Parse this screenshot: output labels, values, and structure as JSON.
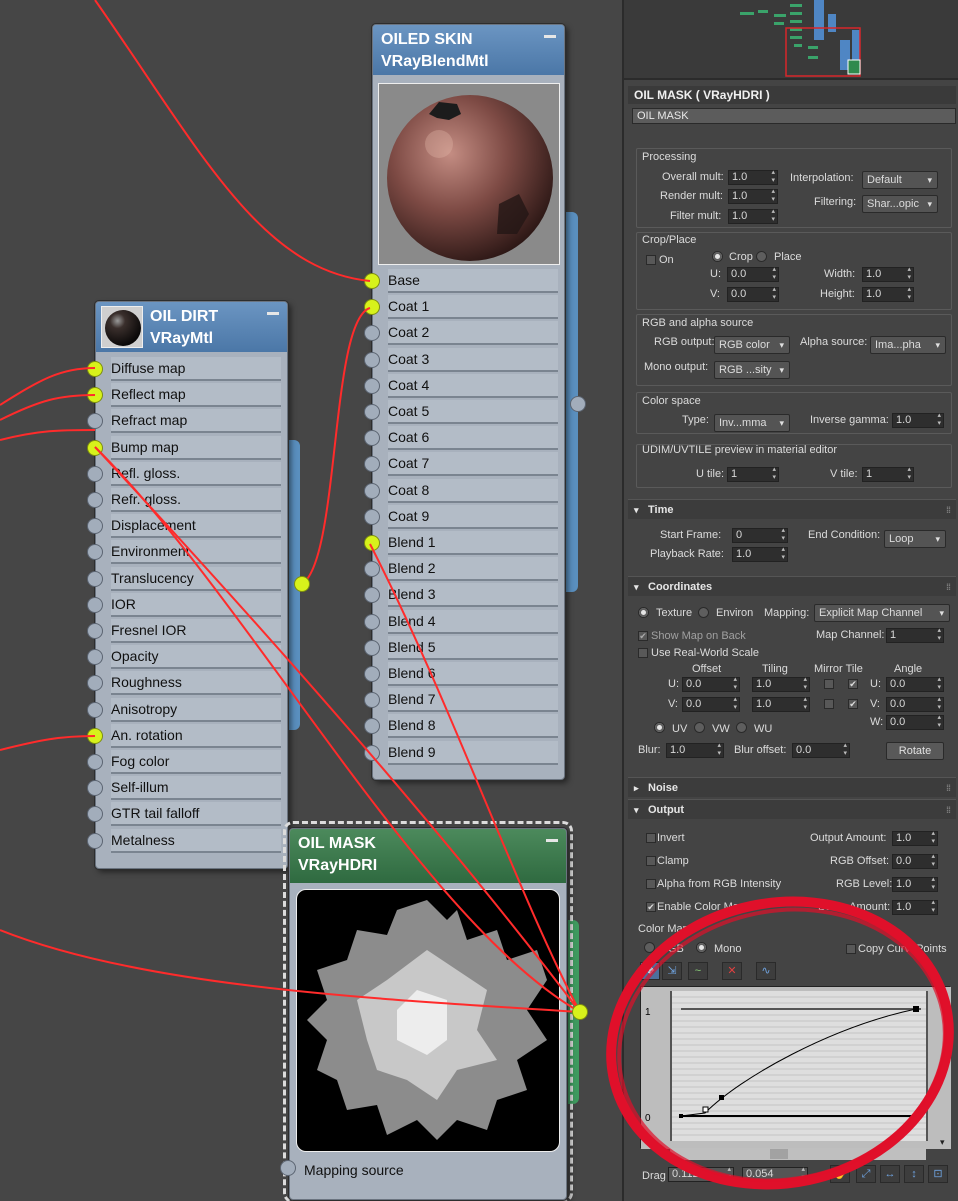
{
  "nodes": {
    "oiled_skin": {
      "title": "OILED SKIN",
      "subtitle": "VRayBlendMtl",
      "slots": [
        "Base",
        "Coat 1",
        "Coat 2",
        "Coat 3",
        "Coat 4",
        "Coat 5",
        "Coat 6",
        "Coat 7",
        "Coat 8",
        "Coat 9",
        "Blend 1",
        "Blend 2",
        "Blend 3",
        "Blend 4",
        "Blend 5",
        "Blend 6",
        "Blend 7",
        "Blend 8",
        "Blend 9"
      ],
      "connected_slots": [
        "Base",
        "Coat 1",
        "Blend 1"
      ]
    },
    "oil_dirt": {
      "title": "OIL DIRT",
      "subtitle": "VRayMtl",
      "slots": [
        "Diffuse map",
        "Reflect map",
        "Refract map",
        "Bump map",
        "Refl. gloss.",
        "Refr. gloss.",
        "Displacement",
        "Environment",
        "Translucency",
        "IOR",
        "Fresnel IOR",
        "Opacity",
        "Roughness",
        "Anisotropy",
        "An. rotation",
        "Fog color",
        "Self-illum",
        "GTR tail falloff",
        "Metalness"
      ],
      "connected_slots": [
        "Diffuse map",
        "Reflect map",
        "Bump map",
        "An. rotation"
      ]
    },
    "oil_mask": {
      "title": "OIL MASK",
      "subtitle": "VRayHDRI",
      "slots": [
        "Mapping source"
      ]
    }
  },
  "panel": {
    "title": "OIL MASK  ( VRayHDRI )",
    "name_field": "OIL MASK",
    "processing": {
      "label": "Processing",
      "overall_mult_label": "Overall mult:",
      "overall_mult": "1.0",
      "render_mult_label": "Render mult:",
      "render_mult": "1.0",
      "filter_mult_label": "Filter mult:",
      "filter_mult": "1.0",
      "interpolation_label": "Interpolation:",
      "interpolation": "Default",
      "filtering_label": "Filtering:",
      "filtering": "Shar...opic"
    },
    "crop_place": {
      "label": "Crop/Place",
      "on_label": "On",
      "crop_label": "Crop",
      "place_label": "Place",
      "u_label": "U:",
      "u": "0.0",
      "v_label": "V:",
      "v": "0.0",
      "width_label": "Width:",
      "width": "1.0",
      "height_label": "Height:",
      "height": "1.0"
    },
    "rgb_alpha": {
      "label": "RGB and alpha source",
      "rgb_output_label": "RGB output:",
      "rgb_output": "RGB color",
      "alpha_source_label": "Alpha source:",
      "alpha_source": "Ima...pha",
      "mono_output_label": "Mono output:",
      "mono_output": "RGB ...sity"
    },
    "color_space": {
      "label": "Color space",
      "type_label": "Type:",
      "type": "Inv...mma",
      "inverse_gamma_label": "Inverse gamma:",
      "inverse_gamma": "1.0"
    },
    "udim": {
      "label": "UDIM/UVTILE preview in material editor",
      "u_tile_label": "U tile:",
      "u_tile": "1",
      "v_tile_label": "V tile:",
      "v_tile": "1"
    },
    "time": {
      "label": "Time",
      "start_frame_label": "Start Frame:",
      "start_frame": "0",
      "playback_rate_label": "Playback Rate:",
      "playback_rate": "1.0",
      "end_condition_label": "End Condition:",
      "end_condition": "Loop"
    },
    "coordinates": {
      "label": "Coordinates",
      "texture_label": "Texture",
      "environ_label": "Environ",
      "mapping_label": "Mapping:",
      "mapping": "Explicit Map Channel",
      "show_map_label": "Show Map on Back",
      "map_channel_label": "Map Channel:",
      "map_channel": "1",
      "real_world_label": "Use Real-World Scale",
      "offset_label": "Offset",
      "tiling_label": "Tiling",
      "mirror_tile_label": "Mirror Tile",
      "angle_label": "Angle",
      "u_label": "U:",
      "v_label": "V:",
      "w_label": "W:",
      "u_offset": "0.0",
      "v_offset": "0.0",
      "u_tiling": "1.0",
      "v_tiling": "1.0",
      "u_angle": "0.0",
      "v_angle": "0.0",
      "w_angle": "0.0",
      "uv_label": "UV",
      "vw_label": "VW",
      "wu_label": "WU",
      "blur_label": "Blur:",
      "blur": "1.0",
      "blur_offset_label": "Blur offset:",
      "blur_offset": "0.0",
      "rotate_label": "Rotate"
    },
    "noise": {
      "label": "Noise"
    },
    "output": {
      "label": "Output",
      "invert_label": "Invert",
      "clamp_label": "Clamp",
      "alpha_from_rgb_label": "Alpha from RGB Intensity",
      "enable_color_map_label": "Enable Color Map",
      "output_amount_label": "Output Amount:",
      "output_amount": "1.0",
      "rgb_offset_label": "RGB Offset:",
      "rgb_offset": "0.0",
      "rgb_level_label": "RGB Level:",
      "rgb_level": "1.0",
      "bump_amount_label": "Bump Amount:",
      "bump_amount": "1.0",
      "color_map_label": "Color Map :",
      "rgb_label": "RGB",
      "mono_label": "Mono",
      "copy_curve_label": "Copy CurvePoints",
      "curve_top_label": "1",
      "curve_bottom_label": "0",
      "drag_label": "Drag",
      "drag_x": "0.112",
      "drag_y": "0.054"
    }
  },
  "colors": {
    "wire": "#ff2b2b",
    "socket_active": "#d7f21b",
    "annotation_circle": "#e0102a",
    "header_blue": "#5a86b8",
    "header_green": "#3a7a4d"
  }
}
